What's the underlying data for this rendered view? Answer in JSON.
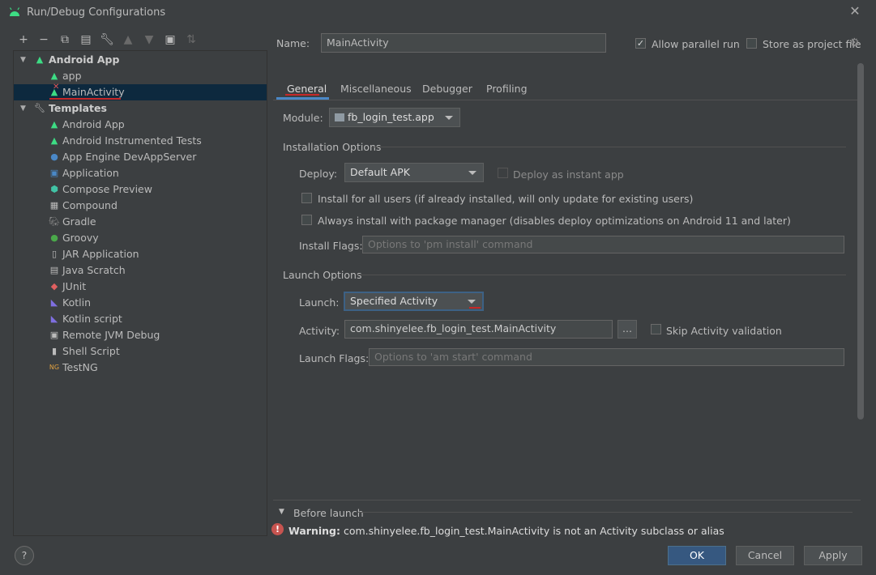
{
  "window": {
    "title": "Run/Debug Configurations",
    "accent": "#4a88c7",
    "error_color": "#c75450"
  },
  "toolbar": {
    "icons": [
      "add-icon",
      "remove-icon",
      "copy-icon",
      "save-icon",
      "wrench-icon",
      "move-up-icon",
      "move-down-icon",
      "new-folder-icon",
      "sort-icon"
    ]
  },
  "tree": {
    "android_app": "Android App",
    "app": "app",
    "main_activity": "MainActivity",
    "templates": "Templates",
    "items": [
      "Android App",
      "Android Instrumented Tests",
      "App Engine DevAppServer",
      "Application",
      "Compose Preview",
      "Compound",
      "Gradle",
      "Groovy",
      "JAR Application",
      "Java Scratch",
      "JUnit",
      "Kotlin",
      "Kotlin script",
      "Remote JVM Debug",
      "Shell Script",
      "TestNG"
    ]
  },
  "header": {
    "name_label": "Name:",
    "name_value": "MainActivity",
    "allow_parallel": "Allow parallel run",
    "store_project": "Store as project file"
  },
  "tabs": [
    "General",
    "Miscellaneous",
    "Debugger",
    "Profiling"
  ],
  "general": {
    "module_label": "Module:",
    "module_value": "fb_login_test.app",
    "installation_title": "Installation Options",
    "deploy_label": "Deploy:",
    "deploy_value": "Default APK",
    "deploy_instant": "Deploy as instant app",
    "install_all_users": "Install for all users (if already installed, will only update for existing users)",
    "always_install": "Always install with package manager (disables deploy optimizations on Android 11 and later)",
    "install_flags_label": "Install Flags:",
    "install_flags_placeholder": "Options to 'pm install' command",
    "launch_title": "Launch Options",
    "launch_label": "Launch:",
    "launch_value": "Specified Activity",
    "activity_label": "Activity:",
    "activity_value": "com.shinyelee.fb_login_test.MainActivity",
    "browse": "...",
    "skip_validation": "Skip Activity validation",
    "launch_flags_label": "Launch Flags:",
    "launch_flags_placeholder": "Options to 'am start' command"
  },
  "before_launch": "Before launch",
  "warning": {
    "bold": "Warning:",
    "text": "com.shinyelee.fb_login_test.MainActivity is not an Activity subclass or alias"
  },
  "buttons": {
    "help": "?",
    "ok": "OK",
    "cancel": "Cancel",
    "apply": "Apply"
  }
}
